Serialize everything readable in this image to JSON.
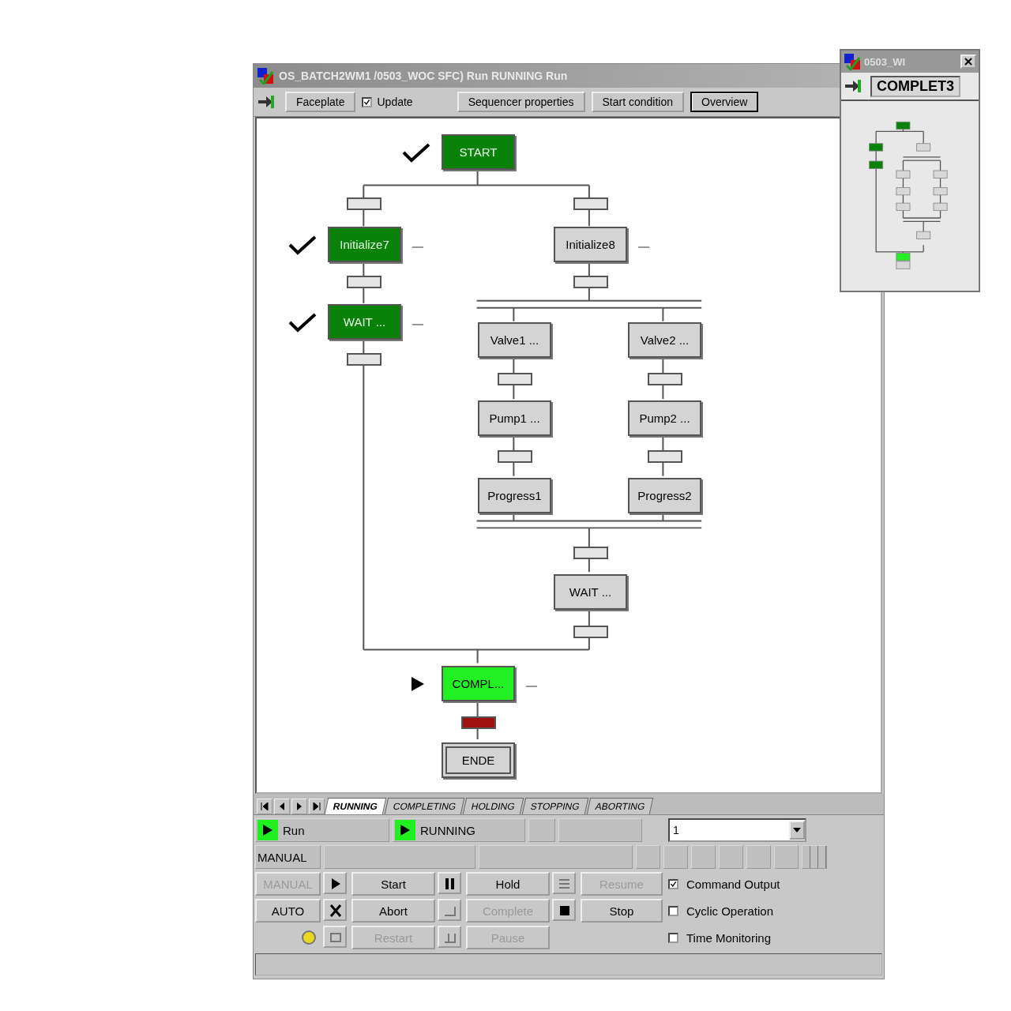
{
  "window": {
    "title": "OS_BATCH2WM1 /0503_WOC SFC) Run RUNNING Run"
  },
  "toolbar": [
    {
      "kind": "button",
      "label": "Faceplate",
      "default": false
    },
    {
      "kind": "checkbox",
      "label": "Update",
      "checked": true
    },
    {
      "kind": "button",
      "label": "Sequencer properties",
      "default": false
    },
    {
      "kind": "button",
      "label": "Start condition",
      "default": false
    },
    {
      "kind": "button",
      "label": "Overview",
      "default": true
    }
  ],
  "steps": [
    {
      "kind": "step",
      "label": "START",
      "completed": true,
      "active": false,
      "comment_mark": false
    },
    {
      "kind": "step",
      "label": "Initialize7",
      "completed": true,
      "active": false,
      "comment_mark": true
    },
    {
      "kind": "step",
      "label": "Initialize8",
      "completed": false,
      "active": false,
      "comment_mark": true
    },
    {
      "kind": "step",
      "label": "WAIT ...",
      "completed": true,
      "active": false,
      "comment_mark": true
    },
    {
      "kind": "step",
      "label": "Valve1 ...",
      "completed": false,
      "active": false,
      "comment_mark": false
    },
    {
      "kind": "step",
      "label": "Valve2 ...",
      "completed": false,
      "active": false,
      "comment_mark": false
    },
    {
      "kind": "step",
      "label": "Pump1 ...",
      "completed": false,
      "active": false,
      "comment_mark": false
    },
    {
      "kind": "step",
      "label": "Pump2 ...",
      "completed": false,
      "active": false,
      "comment_mark": false
    },
    {
      "kind": "step",
      "label": "Progress1",
      "completed": false,
      "active": false,
      "comment_mark": false
    },
    {
      "kind": "step",
      "label": "Progress2",
      "completed": false,
      "active": false,
      "comment_mark": false
    },
    {
      "kind": "step",
      "label": "WAIT ...",
      "completed": false,
      "active": false,
      "comment_mark": false
    },
    {
      "kind": "step",
      "label": "COMPL...",
      "completed": false,
      "active": true,
      "comment_mark": true
    },
    {
      "kind": "end",
      "label": "ENDE",
      "completed": false,
      "active": false,
      "comment_mark": false
    }
  ],
  "transitions": [
    {
      "fault": false
    },
    {
      "fault": false
    },
    {
      "fault": false
    },
    {
      "fault": false
    },
    {
      "fault": false
    },
    {
      "fault": false
    },
    {
      "fault": false
    },
    {
      "fault": false
    },
    {
      "fault": false
    },
    {
      "fault": false
    },
    {
      "fault": false
    },
    {
      "fault": true
    }
  ],
  "state_tabs": [
    {
      "label": "RUNNING",
      "selected": true
    },
    {
      "label": "COMPLETING",
      "selected": false
    },
    {
      "label": "HOLDING",
      "selected": false
    },
    {
      "label": "STOPPING",
      "selected": false
    },
    {
      "label": "ABORTING",
      "selected": false
    }
  ],
  "command_status": "Run",
  "sequence_status": "RUNNING",
  "dropdown": {
    "value": "1"
  },
  "mode_label": "MANUAL",
  "mode_buttons": [
    {
      "label": "MANUAL",
      "disabled": true
    },
    {
      "label": "AUTO",
      "disabled": false
    }
  ],
  "commands": [
    {
      "label": "Start",
      "disabled": false
    },
    {
      "label": "Hold",
      "disabled": false
    },
    {
      "label": "Resume",
      "disabled": true
    },
    {
      "label": "Abort",
      "disabled": false
    },
    {
      "label": "Complete",
      "disabled": true
    },
    {
      "label": "Stop",
      "disabled": false
    },
    {
      "label": "Restart",
      "disabled": true
    },
    {
      "label": "Pause",
      "disabled": true
    }
  ],
  "options": [
    {
      "label": "Command Output",
      "checked": true
    },
    {
      "label": "Cyclic Operation",
      "checked": false
    },
    {
      "label": "Time Monitoring",
      "checked": false
    }
  ],
  "overview_window": {
    "title": "0503_WI",
    "step": "COMPLET3"
  }
}
